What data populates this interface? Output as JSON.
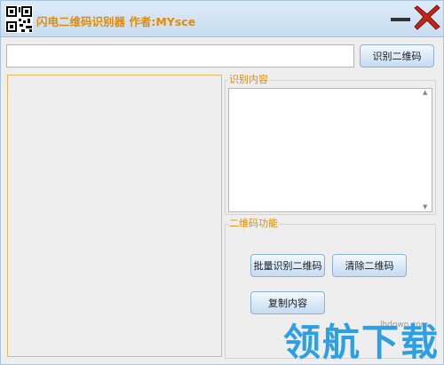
{
  "window": {
    "title": "闪电二维码识别器  作者:MYsce",
    "icons": {
      "app": "qr-code-icon",
      "minimize": "minimize-icon",
      "close": "close-icon"
    },
    "colors": {
      "title_text": "#e68a00",
      "title_bar": "#d3e6f6",
      "close_x": "#c0261c",
      "accent_legend": "#e68a00"
    }
  },
  "toolbar": {
    "path_input_value": "",
    "recognize_label": "识别二维码"
  },
  "result_group": {
    "legend": "识别内容",
    "content": ""
  },
  "function_group": {
    "legend": "二维码功能",
    "batch_label": "批量识别二维码",
    "clear_label": "清除二维码",
    "copy_label": "复制内容"
  },
  "watermark": {
    "url": "lhdown.com",
    "text": "领航下载"
  }
}
